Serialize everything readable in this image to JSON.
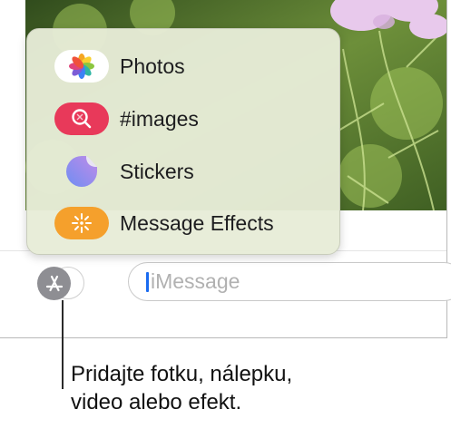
{
  "menu": {
    "items": [
      {
        "label": "Photos",
        "icon": "photos-icon",
        "color": "#ffffff"
      },
      {
        "label": "#images",
        "icon": "images-search-icon",
        "color": "#e8395a"
      },
      {
        "label": "Stickers",
        "icon": "stickers-icon",
        "color": "#7d8ef0"
      },
      {
        "label": "Message Effects",
        "icon": "sparkle-icon",
        "color": "#f5a02c"
      }
    ]
  },
  "composer": {
    "placeholder": "iMessage",
    "app_button_icon": "app-store-icon",
    "app_button_color": "#8e8e93"
  },
  "callout": {
    "line1": "Pridajte fotku, nálepku,",
    "line2": "video alebo efekt."
  }
}
